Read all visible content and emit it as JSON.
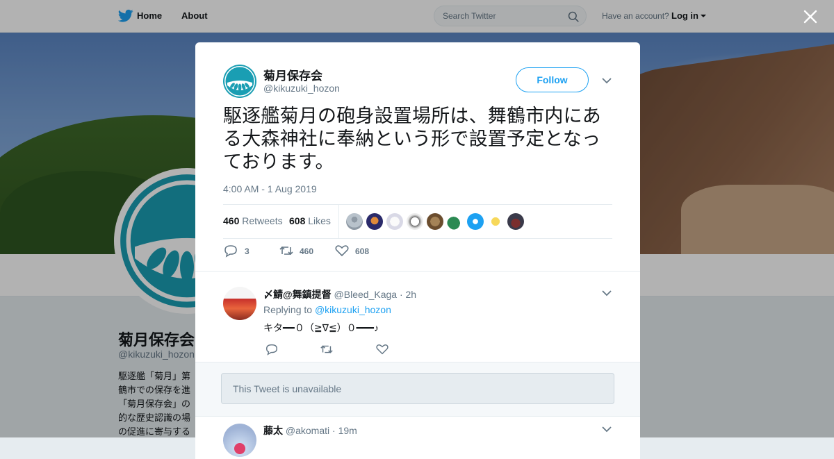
{
  "topbar": {
    "nav": [
      {
        "label": "Home",
        "icon": "twitter-bird-icon"
      },
      {
        "label": "About"
      }
    ],
    "search": {
      "placeholder": "Search Twitter",
      "icon": "search-icon"
    },
    "account_prompt": "Have an account?",
    "login_label": "Log in",
    "close_icon": "close-icon"
  },
  "profile_background": {
    "name": "菊月保存会",
    "handle": "@kikuzuki_hozon",
    "bio_fragment": "駆逐艦「菊月」第 鶴市での保存を進 「菊月保存会」の 的な歴史認識の場 の促進に寄与する"
  },
  "tweet": {
    "author_name": "菊月保存会",
    "author_handle": "@kikuzuki_hozon",
    "follow_label": "Follow",
    "text": "駆逐艦菊月の砲身設置場所は、舞鶴市内にある大森神社に奉納という形で設置予定となっております。",
    "timestamp": "4:00 AM - 1 Aug 2019",
    "retweets_count": "460",
    "retweets_label": "Retweets",
    "likes_count": "608",
    "likes_label": "Likes",
    "liker_avatar_count": 9,
    "actions": {
      "reply_count": "3",
      "retweet_count": "460",
      "like_count": "608"
    }
  },
  "replies": [
    {
      "name": "〆鯖@舞鎮提督",
      "handle": "@Bleed_Kaga",
      "time": "· 2h",
      "replying_prefix": "Replying to",
      "replying_to": "@kikuzuki_hozon",
      "text": "キタ━━０（≧∇≦）０━━━♪"
    },
    {
      "name": "藤太",
      "handle": "@akomati",
      "time": "· 19m"
    }
  ],
  "unavailable_notice": "This Tweet is unavailable",
  "colors": {
    "accent": "#1da1f2",
    "brand_teal": "#1a9eb3",
    "text_primary": "#14171a",
    "text_secondary": "#657786"
  }
}
